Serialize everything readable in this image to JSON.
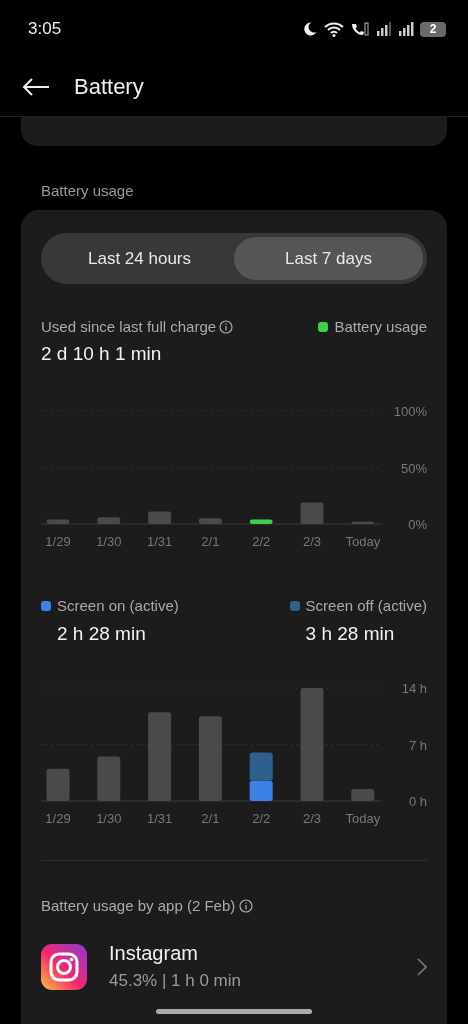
{
  "status_bar": {
    "time": "3:05",
    "battery": "2"
  },
  "app_bar": {
    "title": "Battery"
  },
  "section_label": "Battery usage",
  "tabs": [
    {
      "label": "Last 24 hours",
      "selected": false
    },
    {
      "label": "Last 7 days",
      "selected": true
    }
  ],
  "usage": {
    "label": "Used since last full charge",
    "legend": {
      "label": "Battery usage",
      "color": "#3ecf4a"
    },
    "total": "2 d 10 h 1 min",
    "chart_data": {
      "type": "bar",
      "categories": [
        "1/29",
        "1/30",
        "1/31",
        "2/1",
        "2/2",
        "2/3",
        "Today"
      ],
      "ylim": [
        0,
        100
      ],
      "yticks": [
        {
          "value": 0,
          "label": "0%"
        },
        {
          "value": 50,
          "label": "50%"
        },
        {
          "value": 100,
          "label": "100%"
        }
      ],
      "series": [
        {
          "color": "#3ecf4a",
          "values": [
            null,
            null,
            null,
            null,
            4,
            null,
            null
          ]
        },
        {
          "color": "#4a4a4a",
          "values": [
            4,
            6,
            11,
            5,
            null,
            19,
            2
          ]
        }
      ]
    }
  },
  "screen_time": {
    "legends": [
      {
        "label": "Screen on (active)",
        "color": "#3b82e8",
        "value": "2 h 28 min"
      },
      {
        "label": "Screen off (active)",
        "color": "#2f5f8c",
        "value": "3 h 28 min"
      }
    ],
    "chart_data": {
      "type": "bar",
      "stacked": true,
      "categories": [
        "1/29",
        "1/30",
        "1/31",
        "2/1",
        "2/2",
        "2/3",
        "Today"
      ],
      "ylim": [
        0,
        14
      ],
      "yticks": [
        {
          "value": 0,
          "label": "0 h"
        },
        {
          "value": 7,
          "label": "7 h"
        },
        {
          "value": 14,
          "label": "14 h"
        }
      ],
      "series": [
        {
          "color": "#3b82e8",
          "values": [
            null,
            null,
            null,
            null,
            2.5,
            null,
            null
          ]
        },
        {
          "color": "#2f5f8c",
          "values": [
            null,
            null,
            null,
            null,
            3.5,
            null,
            null
          ]
        },
        {
          "color": "#4a4a4a",
          "values": [
            4,
            5.5,
            11,
            10.5,
            null,
            14,
            1.5
          ]
        }
      ]
    }
  },
  "apps": {
    "title": "Battery usage by app (2 Feb)",
    "items": [
      {
        "name": "Instagram",
        "detail": "45.3% | 1 h 0 min"
      }
    ]
  }
}
